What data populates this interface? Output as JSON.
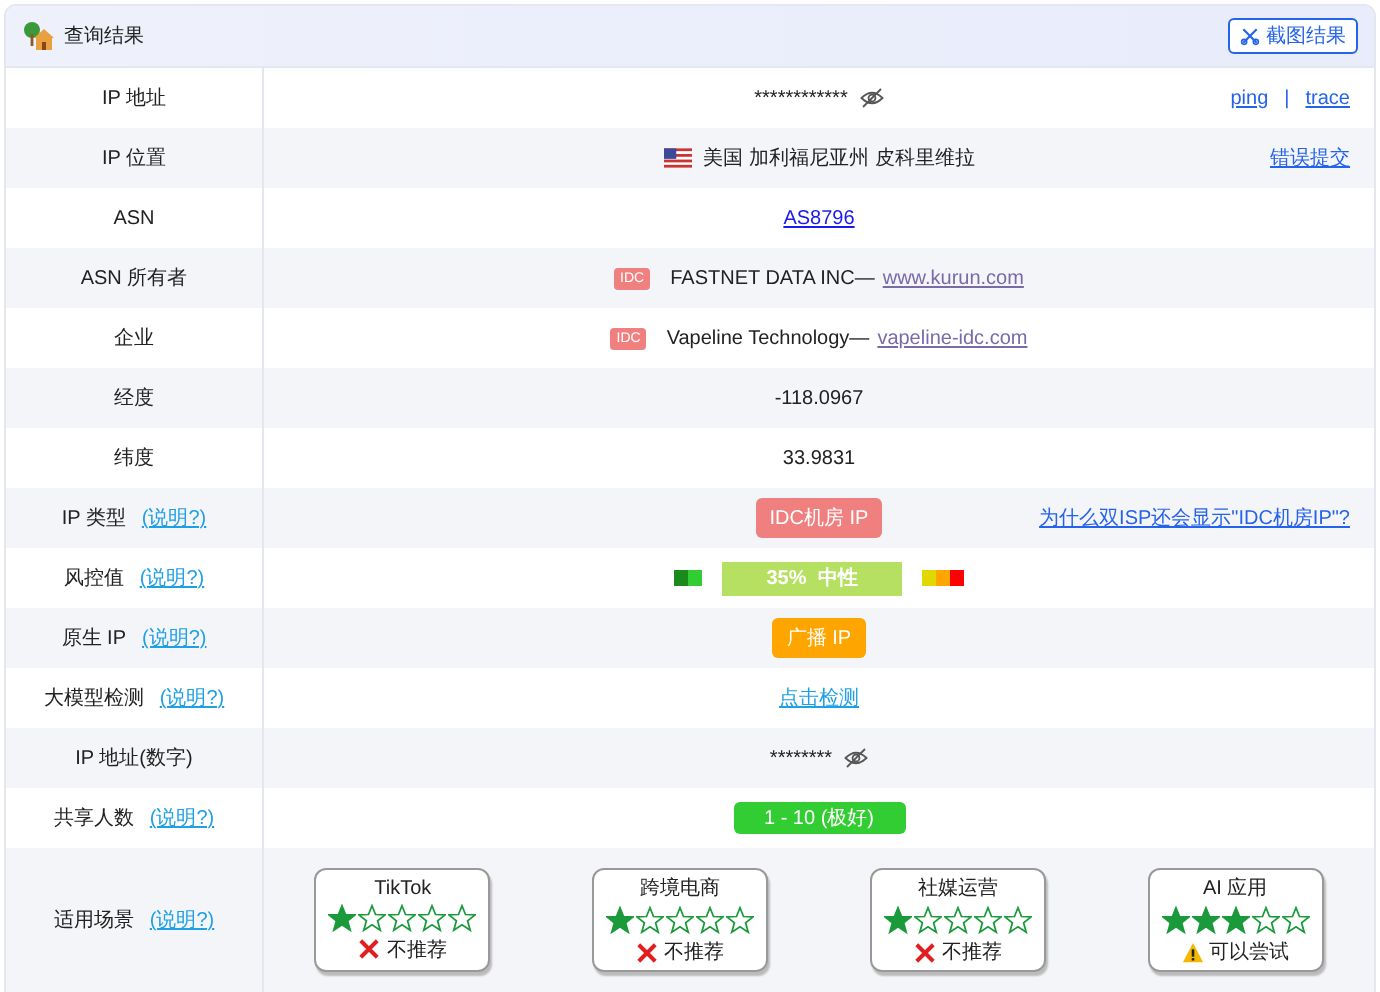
{
  "header": {
    "title": "查询结果",
    "button": "截图结果"
  },
  "rows": [
    {
      "kind": "masked",
      "label": "IP 地址",
      "value": "************",
      "links": [
        "ping",
        "trace"
      ],
      "separator": "|"
    },
    {
      "kind": "location",
      "label": "IP 位置",
      "value": "美国 加利福尼亚州 皮科里维拉",
      "side_link": "错误提交"
    },
    {
      "kind": "link",
      "label": "ASN",
      "value": "AS8796"
    },
    {
      "kind": "org",
      "label": "ASN 所有者",
      "badge": "IDC",
      "name": "FASTNET DATA INC—",
      "url": "www.kurun.com"
    },
    {
      "kind": "org",
      "label": "企业",
      "badge": "IDC",
      "name": "Vapeline Technology—",
      "url": "vapeline-idc.com"
    },
    {
      "kind": "plain",
      "label": "经度",
      "value": "-118.0967"
    },
    {
      "kind": "plain",
      "label": "纬度",
      "value": "33.9831"
    },
    {
      "kind": "tag",
      "label": "IP 类型",
      "help": "(说明?)",
      "value": "IDC机房 IP",
      "color": "#f08080",
      "side_link": "为什么双ISP还会显示\"IDC机房IP\"?"
    },
    {
      "kind": "risk",
      "label": "风控值",
      "help": "(说明?)",
      "value": "35%",
      "verdict": "中性"
    },
    {
      "kind": "tag",
      "label": "原生 IP",
      "help": "(说明?)",
      "value": "广播 IP",
      "color": "#ffa500"
    },
    {
      "kind": "action",
      "label": "大模型检测",
      "help": "(说明?)",
      "value": "点击检测"
    },
    {
      "kind": "masked",
      "label": "IP 地址(数字)",
      "value": "********"
    },
    {
      "kind": "bar",
      "label": "共享人数",
      "help": "(说明?)",
      "value": "1 - 10 (极好)"
    },
    {
      "kind": "scenarios",
      "label": "适用场景",
      "help": "(说明?)",
      "items": [
        {
          "name": "TikTok",
          "stars": 1,
          "verdict": "不推荐",
          "kind": "no"
        },
        {
          "name": "跨境电商",
          "stars": 1,
          "verdict": "不推荐",
          "kind": "no"
        },
        {
          "name": "社媒运营",
          "stars": 1,
          "verdict": "不推荐",
          "kind": "no"
        },
        {
          "name": "AI 应用",
          "stars": 3,
          "verdict": "可以尝试",
          "kind": "maybe"
        }
      ]
    }
  ]
}
